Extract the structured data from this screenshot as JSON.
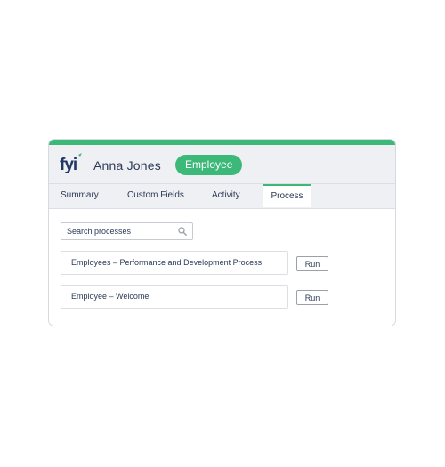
{
  "colors": {
    "accent": "#3cb878",
    "text": "#2b3a55",
    "header_bg": "#eff0f4",
    "logo": "#1f3864"
  },
  "header": {
    "logo_text": "fyi",
    "logo_icon": "fyi-logo-icon",
    "name": "Anna Jones",
    "badge": "Employee"
  },
  "tabs": [
    {
      "label": "Summary",
      "active": false
    },
    {
      "label": "Custom Fields",
      "active": false
    },
    {
      "label": "Activity",
      "active": false
    },
    {
      "label": "Process",
      "active": true
    }
  ],
  "search": {
    "placeholder": "Search processes",
    "value": "",
    "icon": "search-icon"
  },
  "processes": [
    {
      "label": "Employees – Performance and Development Process",
      "action": "Run"
    },
    {
      "label": "Employee – Welcome",
      "action": "Run"
    }
  ]
}
